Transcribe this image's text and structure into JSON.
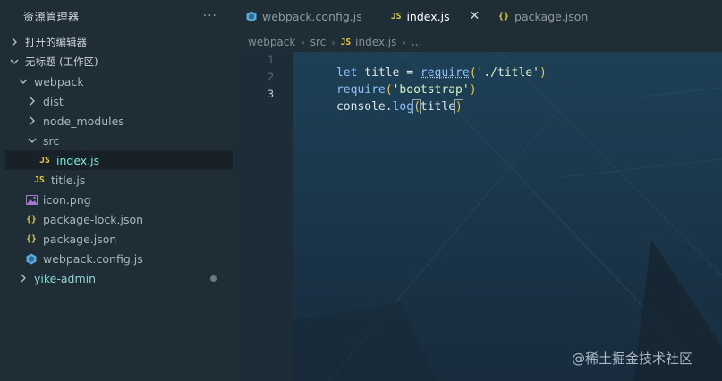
{
  "sidebar": {
    "title": "资源管理器",
    "more": "···",
    "open_editors": "打开的编辑器",
    "workspace": "无标题 (工作区)",
    "tree": {
      "webpack": "webpack",
      "dist": "dist",
      "node_modules": "node_modules",
      "src": "src",
      "index_js": "index.js",
      "title_js": "title.js",
      "icon_png": "icon.png",
      "package_lock_json": "package-lock.json",
      "package_json": "package.json",
      "webpack_config_js": "webpack.config.js",
      "yike_admin": "yike-admin"
    },
    "js_glyph": "JS",
    "json_glyph": "{}"
  },
  "tabs": [
    {
      "label": "webpack.config.js"
    },
    {
      "label": "index.js",
      "close": "✕"
    },
    {
      "label": "package.json"
    }
  ],
  "breadcrumb": {
    "items": [
      "webpack",
      "src",
      "index.js",
      "..."
    ]
  },
  "editor": {
    "line_numbers": [
      "1",
      "2",
      "3"
    ],
    "lines": [
      {
        "tokens": [
          "let",
          "title",
          "=",
          "require",
          "(",
          "'./title'",
          ")"
        ]
      },
      {
        "tokens": [
          "require",
          "(",
          "'bootstrap'",
          ")"
        ]
      },
      {
        "tokens": [
          "console",
          ".",
          "log",
          "(",
          "title",
          ")"
        ]
      }
    ]
  },
  "watermark": "@稀土掘金技术社区",
  "colors": {
    "sidebar_bg": "#1f2d36",
    "js_yellow": "#e4cc45",
    "selected_teal": "#8ce0d8",
    "keyword_blue": "#8fc1ff",
    "string_green": "#d7f0c9"
  }
}
